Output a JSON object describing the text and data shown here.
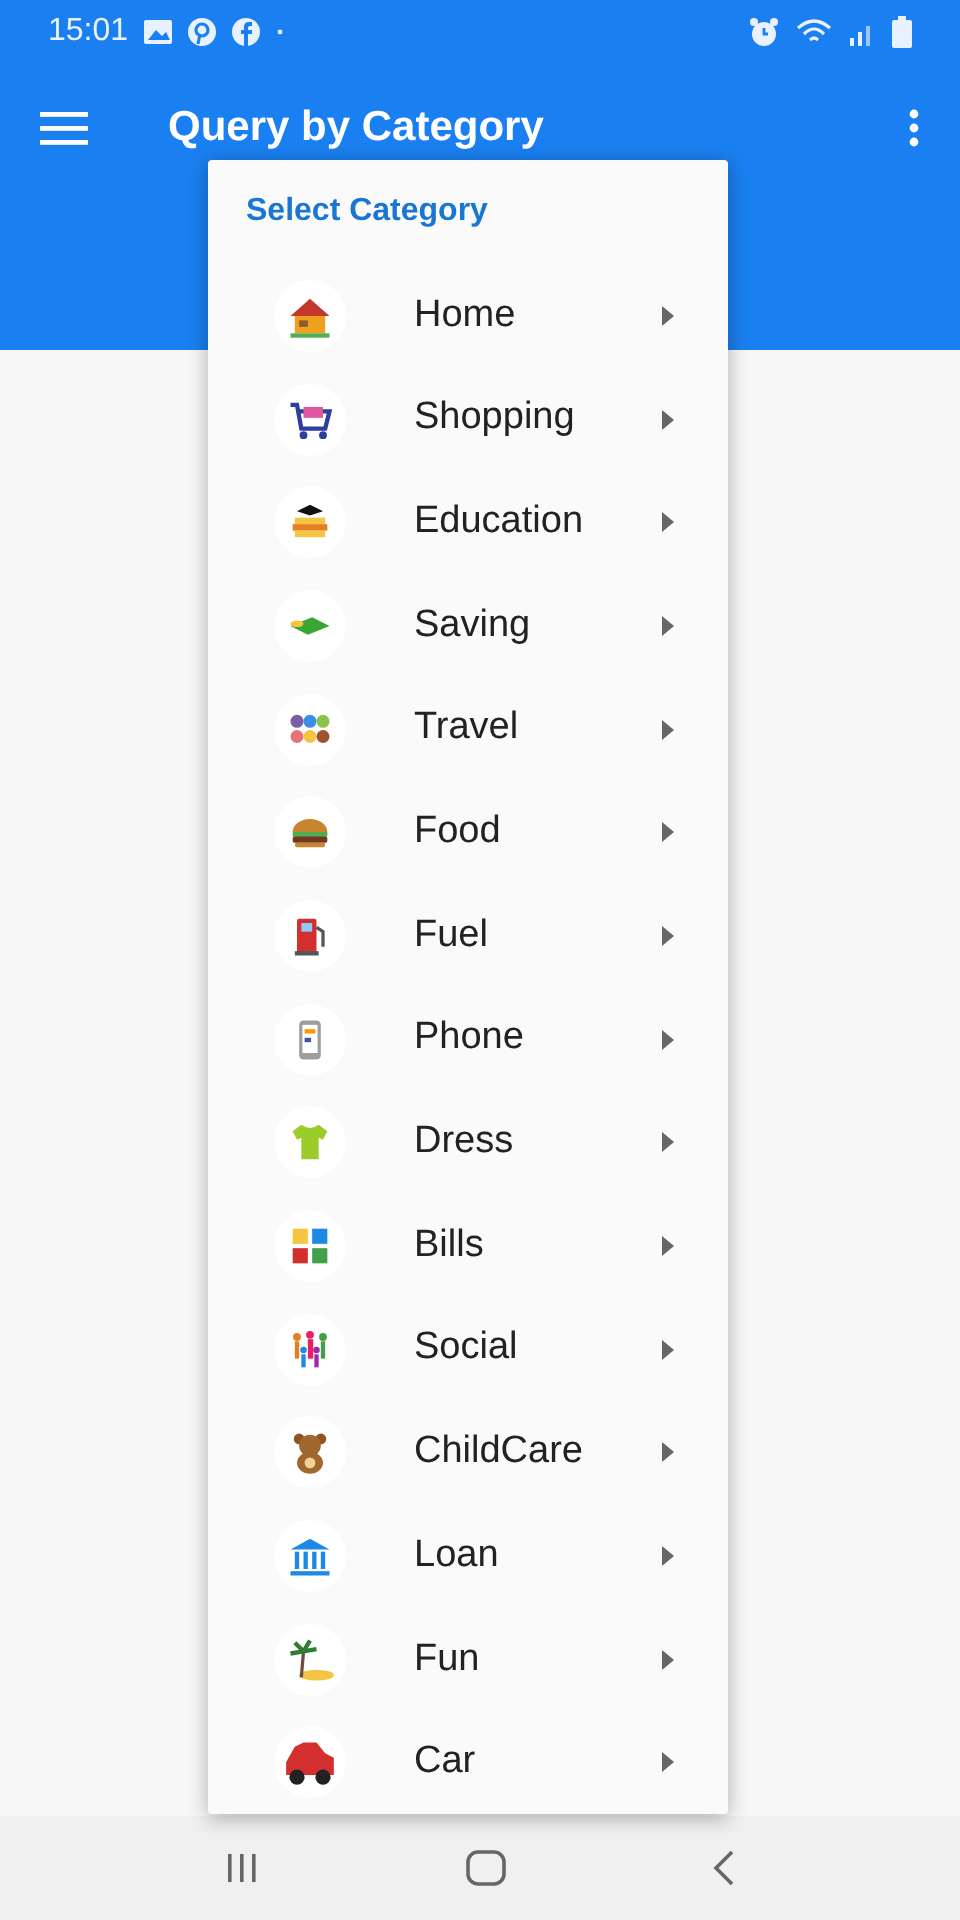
{
  "status_bar": {
    "time": "15:01"
  },
  "app_bar": {
    "title": "Query by Category"
  },
  "menu": {
    "title": "Select Category",
    "items": [
      {
        "label": "Home"
      },
      {
        "label": "Shopping"
      },
      {
        "label": "Education"
      },
      {
        "label": "Saving"
      },
      {
        "label": "Travel"
      },
      {
        "label": "Food"
      },
      {
        "label": "Fuel"
      },
      {
        "label": "Phone"
      },
      {
        "label": "Dress"
      },
      {
        "label": "Bills"
      },
      {
        "label": "Social"
      },
      {
        "label": "ChildCare"
      },
      {
        "label": "Loan"
      },
      {
        "label": "Fun"
      },
      {
        "label": "Car"
      }
    ]
  }
}
